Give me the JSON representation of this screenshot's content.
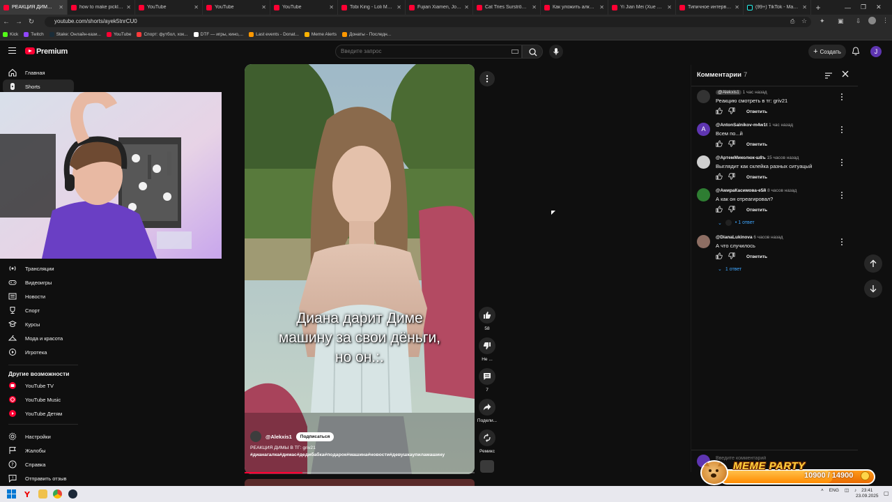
{
  "browser": {
    "tabs": [
      {
        "title": "РЕАКЦИЯ ДИМЫ В ТГ:",
        "active": true,
        "icon": "youtube"
      },
      {
        "title": "how to make pickle pie",
        "icon": "youtube"
      },
      {
        "title": "YouTube",
        "icon": "youtube"
      },
      {
        "title": "YouTube",
        "icon": "youtube"
      },
      {
        "title": "YouTube",
        "icon": "youtube"
      },
      {
        "title": "Tobi King - Loli Mou (с",
        "icon": "youtube"
      },
      {
        "title": "Fujian Xiamen, John P",
        "icon": "youtube"
      },
      {
        "title": "Cat Tries Surströmming",
        "icon": "youtube"
      },
      {
        "title": "Как уложить алкаша",
        "icon": "youtube"
      },
      {
        "title": "Yi Jian Mei (Xue Hua P",
        "icon": "youtube"
      },
      {
        "title": "Типичное интервью",
        "icon": "youtube"
      },
      {
        "title": "(99+) TikTok - Make Yo",
        "icon": "tiktok"
      }
    ],
    "url": "youtube.com/shorts/ayek5tnrCU0",
    "bookmarks": [
      {
        "label": "Kick",
        "color": "#53fc18"
      },
      {
        "label": "Twitch",
        "color": "#9146ff"
      },
      {
        "label": "Stake: Онлайн-кази...",
        "color": "#1a2c38"
      },
      {
        "label": "YouTube",
        "color": "#ff0033"
      },
      {
        "label": "Спорт: футбол, хок...",
        "color": "#ff3b3b"
      },
      {
        "label": "DTF — игры, кино,...",
        "color": "#ffffff"
      },
      {
        "label": "Last events - Donat...",
        "color": "#ff9800"
      },
      {
        "label": "Meme Alerts",
        "color": "#ffb300"
      },
      {
        "label": "Донаты - Последн...",
        "color": "#ff9800"
      }
    ]
  },
  "youtube": {
    "brand": "Premium",
    "search_placeholder": "Введите запрос",
    "create_label": "Создать",
    "avatar_letter": "J",
    "sidebar_top": [
      {
        "label": "Главная",
        "icon": "home-icon"
      },
      {
        "label": "Shorts",
        "icon": "shorts-icon",
        "active": true
      }
    ],
    "sidebar_explore": [
      {
        "label": "Трансляции",
        "icon": "live-icon"
      },
      {
        "label": "Видеоигры",
        "icon": "gaming-icon"
      },
      {
        "label": "Новости",
        "icon": "news-icon"
      },
      {
        "label": "Спорт",
        "icon": "trophy-icon"
      },
      {
        "label": "Курсы",
        "icon": "courses-icon"
      },
      {
        "label": "Мода и красота",
        "icon": "hanger-icon"
      },
      {
        "label": "Игротека",
        "icon": "playables-icon"
      }
    ],
    "more_heading": "Другие возможности",
    "sidebar_more": [
      {
        "label": "YouTube TV",
        "icon": "youtube-tv-icon"
      },
      {
        "label": "YouTube Music",
        "icon": "youtube-music-icon"
      },
      {
        "label": "YouTube Детям",
        "icon": "youtube-kids-icon"
      }
    ],
    "sidebar_bottom": [
      {
        "label": "Настройки",
        "icon": "gear-icon"
      },
      {
        "label": "Жалобы",
        "icon": "flag-icon"
      },
      {
        "label": "Справка",
        "icon": "help-icon"
      },
      {
        "label": "Отправить отзыв",
        "icon": "feedback-icon"
      }
    ]
  },
  "short": {
    "caption_lines": [
      "Диана дарит Диме",
      "машину за свои дёньги,",
      "но он.:."
    ],
    "channel": "@Alekxis1",
    "subscribe_label": "Подписаться",
    "description_line1": "РЕАКЦИЯ ДИМЫ В ТГ: griv21",
    "description_tags": "#дианагалка#димас#дедибабка#подарок#машина#новости#девушкаупиламашину",
    "progress_fraction": 0.25,
    "actions": {
      "likes": "58",
      "dislike": "Не ...",
      "comments": "7",
      "share": "Подели...",
      "remix": "Ремикс"
    }
  },
  "comments": {
    "title": "Комментарии",
    "count": "7",
    "input_placeholder": "Введите комментарий",
    "reply_label": "Ответить",
    "items": [
      {
        "author": "@Alekxis1",
        "time": "1 час назад",
        "text": "Реакцию смотреть в тг: griv21",
        "avatar_color": "#333333",
        "avatar_letter": "",
        "pill": true
      },
      {
        "author": "@AntonSalnikov-m4w1t",
        "time": "1 час назад",
        "text": "Всем по...й",
        "avatar_color": "#5e35b1",
        "avatar_letter": "A"
      },
      {
        "author": "@АртемМиколюк-ш8ъ",
        "time": "15 часов назад",
        "text": "Выглядит как склейка разных ситуацый",
        "avatar_color": "#cfcfcf",
        "avatar_letter": ""
      },
      {
        "author": "@АмираКасимова-е5й",
        "time": "8 часов назад",
        "text": "А как он отреагировал?",
        "avatar_color": "#2e7d32",
        "avatar_letter": "",
        "replies": "• 1 ответ"
      },
      {
        "author": "@DianaLukinova",
        "time": "6 часов назад",
        "text": "А что случилось",
        "avatar_color": "#8d6e63",
        "avatar_letter": "",
        "replies": "1 ответ"
      }
    ]
  },
  "overlay": {
    "title": "MEME PARTY",
    "progress_text": "10900 / 14900",
    "progress_current": 10900,
    "progress_total": 14900
  },
  "taskbar": {
    "lang": "ENG",
    "time": "23:41",
    "date": "23.09.2025"
  },
  "colors": {
    "accent": "#ff0033",
    "link": "#3ea6ff",
    "overlay_orange": "#ff9a1a"
  }
}
